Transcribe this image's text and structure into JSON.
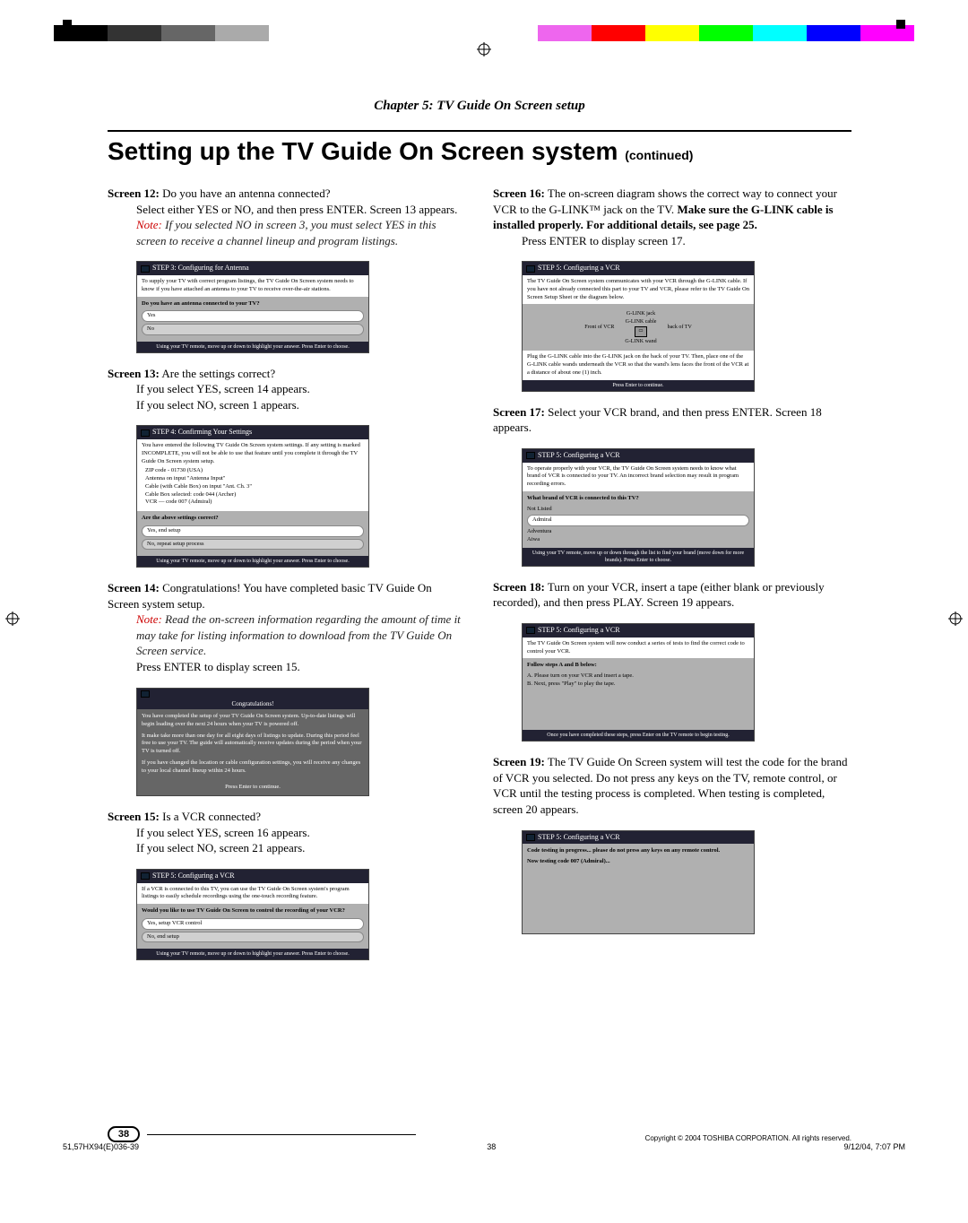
{
  "chapter": "Chapter 5: TV Guide On Screen setup",
  "heading": "Setting up the TV Guide On Screen system",
  "heading_cont": "(continued)",
  "left": {
    "s12": {
      "lead": "Screen 12:",
      "desc": " Do you have an antenna connected?",
      "body": "Select either YES or NO, and then press ENTER. Screen 13 appears.",
      "note_lbl": "Note:",
      "note": " If you selected NO in screen 3, you must select YES in this screen to receive a channel lineup and program listings."
    },
    "s12_thumb": {
      "hdr": "STEP 3: Configuring for Antenna",
      "top": "To supply your TV with correct program listings, the TV Guide On Screen system needs to know if you have attached an antenna to your TV to receive over-the-air stations.",
      "q": "Do you have an antenna connected to your TV?",
      "opts": [
        "Yes",
        "No"
      ],
      "ftr": "Using your TV remote, move up or down to highlight your answer. Press Enter to choose."
    },
    "s13": {
      "lead": "Screen 13:",
      "desc": " Are the settings correct?",
      "body1": "If you select YES, screen 14 appears.",
      "body2": "If you select NO, screen 1 appears."
    },
    "s13_thumb": {
      "hdr": "STEP 4: Confirming Your Settings",
      "top": "You have entered the following TV Guide On Screen system settings. If any setting is marked INCOMPLETE, you will not be able to use that feature until you complete it through the TV Guide On Screen system setup.",
      "lines": [
        "ZIP code - 01730 (USA)",
        "Antenna on input \"Antenna Input\"",
        "Cable (with Cable Box) on input \"Ant. Ch. 3\"",
        "Cable Box selected: code 044 (Archer)",
        "VCR — code 007 (Admiral)"
      ],
      "q": "Are the above settings correct?",
      "opts": [
        "Yes, end setup",
        "No, repeat setup process"
      ],
      "ftr": "Using your TV remote, move up or down to highlight your answer. Press Enter to choose."
    },
    "s14": {
      "lead": "Screen 14:",
      "desc": " Congratulations! You have completed basic TV Guide On Screen system setup.",
      "note_lbl": "Note:",
      "note": " Read the on-screen information regarding the amount of time it may take for listing information to download from the TV Guide On Screen service.",
      "body": "Press ENTER to display screen 15."
    },
    "s14_thumb": {
      "hdr": "Congratulations!",
      "p1": "You have completed the setup of your TV Guide On Screen system. Up-to-date listings will begin loading over the next 24 hours when your TV is powered off.",
      "p2": "It make take more than one day for all eight days of listings to update. During this period feel free to use your TV. The guide will automatically receive updates during the period when your TV is turned off.",
      "p3": "If you have changed the location or cable configuration settings, you will receive any changes to your local channel lineup within 24 hours.",
      "ftr": "Press Enter to continue."
    },
    "s15": {
      "lead": "Screen 15:",
      "desc": " Is a VCR connected?",
      "body1": "If you select YES, screen 16 appears.",
      "body2": "If you select NO, screen 21 appears."
    },
    "s15_thumb": {
      "hdr": "STEP 5: Configuring a VCR",
      "top": "If a VCR is connected to this TV, you can use the TV Guide On Screen system's program listings to easily schedule recordings using the one-touch recording feature.",
      "q": "Would you like to use TV Guide On Screen to control the recording of your VCR?",
      "opts": [
        "Yes, setup VCR control",
        "No, end setup"
      ],
      "ftr": "Using your TV remote, move up or down to highlight your answer. Press Enter to choose."
    }
  },
  "right": {
    "s16": {
      "lead": "Screen 16:",
      "desc": " The on-screen diagram shows the correct way to connect your VCR to the G-LINK™ jack on the TV. ",
      "bold": "Make sure the G-LINK cable is installed properly. For additional details, see page 25.",
      "body": "Press ENTER to display screen 17."
    },
    "s16_thumb": {
      "hdr": "STEP 5: Configuring a VCR",
      "top": "The TV Guide On Screen system communicates with your VCR through the G-LINK cable. If you have not already connected this part to your TV and VCR, please refer to the TV Guide On Screen Setup Sheet or the diagram below.",
      "dia": {
        "front": "Front of VCR",
        "back": "back of TV",
        "glink": "G-LINK jack",
        "cable": "G-LINK cable",
        "wand": "G-LINK wand"
      },
      "bottom": "Plug the G-LINK cable into the G-LINK jack on the back of your TV. Then, place one of the G-LINK cable wands underneath the VCR so that the wand's lens faces the front of the VCR at a distance of about one (1) inch.",
      "ftr": "Press Enter to continue."
    },
    "s17": {
      "lead": "Screen 17:",
      "desc": " Select your VCR brand, and then press ENTER. Screen 18 appears."
    },
    "s17_thumb": {
      "hdr": "STEP 5: Configuring a VCR",
      "top": "To operate properly with your VCR, the TV Guide On Screen system needs to know what brand of VCR is connected to your TV. An incorrect brand selection may result in program recording errors.",
      "q": "What brand of VCR is connected to this TV?",
      "opts": [
        "Not Listed",
        "Admiral",
        "Adventura",
        "Aiwa"
      ],
      "ftr": "Using your TV remote, move up or down through the list to find your brand (move down for more brands). Press Enter to choose."
    },
    "s18": {
      "lead": "Screen 18:",
      "desc": " Turn on your VCR, insert a tape (either blank or previously recorded), and then press PLAY. Screen 19 appears."
    },
    "s18_thumb": {
      "hdr": "STEP 5: Configuring a VCR",
      "top": "The TV Guide On Screen system will now conduct a series of tests to find the correct code to control your VCR.",
      "q": "Follow steps A and B below:",
      "la": "A.   Please turn on your VCR and insert a tape.",
      "lb": "B.   Next, press \"Play\" to play the tape.",
      "ftr": "Once you have completed these steps, press Enter on the TV remote to begin testing."
    },
    "s19": {
      "lead": "Screen 19:",
      "desc": " The TV Guide On Screen system will test the code for the brand of VCR you selected. Do not press any keys on the TV, remote control, or VCR until the testing process is completed. When testing is completed, screen 20 appears."
    },
    "s19_thumb": {
      "hdr": "STEP 5: Configuring a VCR",
      "l1": "Code testing in progress... please do not press any keys on any remote control.",
      "l2": "Now testing code 007 (Admiral)..."
    }
  },
  "copyright": "Copyright © 2004 TOSHIBA CORPORATION. All rights reserved.",
  "pagenum": "38",
  "footer": {
    "file": "51,57HX94(E)036-39",
    "page": "38",
    "date": "9/12/04, 7:07 PM"
  },
  "colors": [
    "#fff",
    "#000",
    "#333",
    "#666",
    "#aaa",
    "#fff",
    "#fff",
    "#fff",
    "#fff",
    "#fff",
    "#e6e",
    "#f00",
    "#ff0",
    "#0f0",
    "#0ff",
    "#00f",
    "#f0f",
    "#fff"
  ]
}
